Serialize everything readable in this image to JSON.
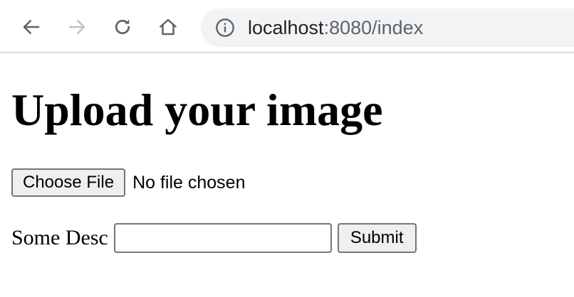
{
  "browser": {
    "toolbar": {
      "back_icon": "arrow-left-icon",
      "forward_icon": "arrow-right-icon",
      "reload_icon": "reload-icon",
      "home_icon": "home-icon"
    },
    "address_bar": {
      "info_icon": "info-circle-icon",
      "host": "localhost",
      "path": ":8080/index"
    }
  },
  "page": {
    "heading": "Upload your image",
    "file_input": {
      "button_label": "Choose File",
      "status_text": "No file chosen"
    },
    "description": {
      "label": "Some Desc",
      "value": "",
      "placeholder": ""
    },
    "submit_label": "Submit"
  },
  "colors": {
    "omnibox_bg": "#f1f3f4",
    "icon_active": "#5f6368",
    "icon_disabled": "#bdc1c6",
    "button_bg": "#efefef",
    "border": "#767676"
  }
}
